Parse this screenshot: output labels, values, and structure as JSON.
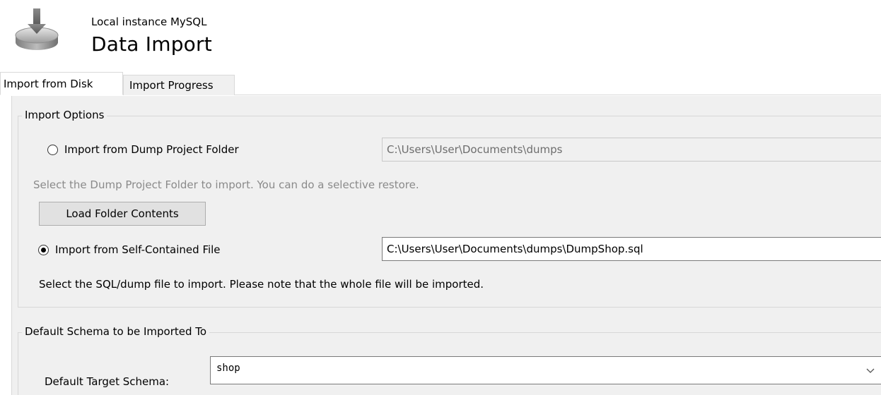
{
  "header": {
    "instance_name": "Local instance MySQL",
    "title": "Data Import",
    "icon": "download-database-icon"
  },
  "tabs": [
    {
      "label": "Import from Disk",
      "active": true
    },
    {
      "label": "Import Progress",
      "active": false
    }
  ],
  "import_options": {
    "legend": "Import Options",
    "dump_folder": {
      "label": "Import from Dump Project Folder",
      "selected": false,
      "path": "C:\\Users\\User\\Documents\\dumps",
      "hint": "Select the Dump Project Folder to import. You can do a selective restore.",
      "load_button": "Load Folder Contents"
    },
    "self_contained": {
      "label": "Import from Self-Contained File",
      "selected": true,
      "path": "C:\\Users\\User\\Documents\\dumps\\DumpShop.sql",
      "hint": "Select the SQL/dump file to import. Please note that the whole file will be imported."
    }
  },
  "default_schema": {
    "legend": "Default Schema to be Imported To",
    "target_label": "Default Target Schema:",
    "target_value": "shop"
  },
  "colors": {
    "panel_bg": "#f0f0f0",
    "border": "#d9d9d9",
    "disabled_text": "#8a8a8a"
  }
}
